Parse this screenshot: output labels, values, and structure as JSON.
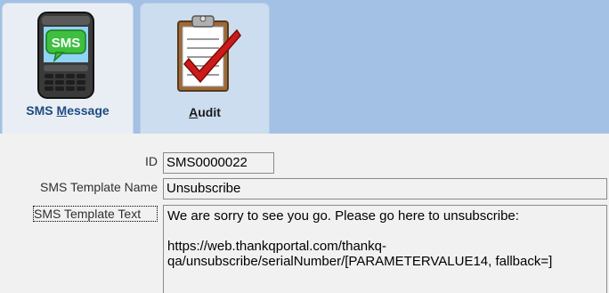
{
  "tabs": [
    {
      "label_before": "SMS ",
      "label_underline": "M",
      "label_after": "essage",
      "icon": "sms-phone-icon",
      "selected": true
    },
    {
      "label_before": "",
      "label_underline": "A",
      "label_after": "udit",
      "icon": "clipboard-check-icon",
      "selected": false
    }
  ],
  "form": {
    "id_label": "ID",
    "id_value": "SMS0000022",
    "name_label": "SMS Template Name",
    "name_value": "Unsubscribe",
    "text_label": "SMS Template Text",
    "text_value": "We are sorry to see you go. Please go here to unsubscribe:\n\nhttps://web.thankqportal.com/thankq-qa/unsubscribe/serialNumber/[PARAMETERVALUE14, fallback=]"
  },
  "colors": {
    "tab_bar": "#a2c1e4",
    "selected_tab_text": "#1e4a80",
    "sms_green": "#3fbf3f",
    "check_red": "#cc1a1a"
  }
}
